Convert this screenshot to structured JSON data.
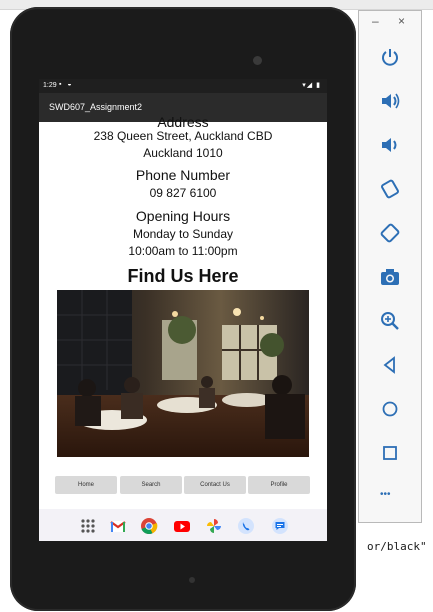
{
  "device": {
    "status_time": "1:29",
    "app_title": "SWD607_Assignment2"
  },
  "screen": {
    "cut_heading": "Address",
    "address_line1": "238 Queen Street, Auckland CBD",
    "address_line2": "Auckland 1010",
    "phone_heading": "Phone Number",
    "phone_value": "09 827 6100",
    "hours_heading": "Opening Hours",
    "hours_days": "Monday to Sunday",
    "hours_times": "10:00am to 11:00pm",
    "find_us": "Find Us Here"
  },
  "nav_buttons": {
    "home": "Home",
    "search": "Search",
    "contact": "Contact Us",
    "profile": "Profile"
  },
  "ide": {
    "snippet": "or/black\""
  },
  "panel": {
    "minimize": "–",
    "close": "×",
    "more": "•••"
  },
  "icons": {
    "apps": "apps-grid-icon",
    "gmail": "gmail-icon",
    "chrome": "chrome-icon",
    "youtube": "youtube-icon",
    "photos": "photos-icon",
    "phone": "phone-icon",
    "messages": "messages-icon"
  }
}
